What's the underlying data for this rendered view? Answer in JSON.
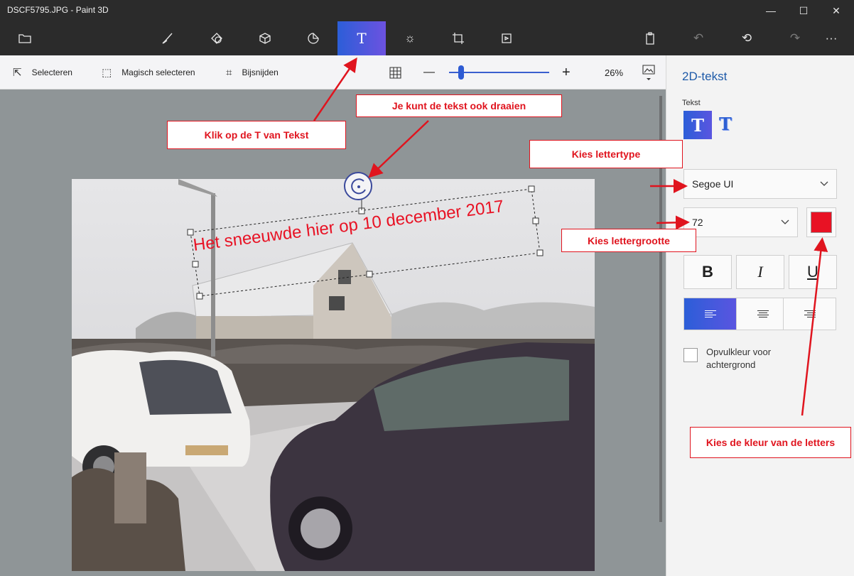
{
  "window": {
    "title": "DSCF5795.JPG - Paint 3D",
    "controls": [
      "—",
      "☐",
      "✕"
    ]
  },
  "toolbar": {
    "tools": [
      {
        "name": "menu",
        "glyph": "🗀"
      },
      {
        "name": "brushes",
        "glyph": "✎"
      },
      {
        "name": "2d-shapes",
        "glyph": "◇"
      },
      {
        "name": "3d-shapes",
        "glyph": "⬡"
      },
      {
        "name": "stickers",
        "glyph": "◔"
      },
      {
        "name": "text",
        "glyph": "T"
      },
      {
        "name": "effects",
        "glyph": "☼"
      },
      {
        "name": "canvas",
        "glyph": "⌗"
      },
      {
        "name": "3d-library",
        "glyph": "⧉"
      }
    ],
    "right": [
      {
        "name": "paste",
        "glyph": "⎘"
      },
      {
        "name": "undo",
        "glyph": "↶"
      },
      {
        "name": "history",
        "glyph": "⟲"
      },
      {
        "name": "redo",
        "glyph": "↷"
      },
      {
        "name": "more",
        "glyph": "···"
      }
    ]
  },
  "subbar": {
    "select_label": "Selecteren",
    "magic_label": "Magisch selecteren",
    "crop_label": "Bijsnijden",
    "zoom_minus": "—",
    "zoom_plus": "+",
    "zoom_value": "26%",
    "zoom_level_fraction": 0.1
  },
  "canvas": {
    "text_on_photo": "Het sneeuwde hier op 10 december 2017",
    "text_color": "#e81224"
  },
  "panel": {
    "title": "2D-tekst",
    "text_label": "Tekst",
    "text_2d_glyph": "T",
    "text_3d_glyph": "T",
    "font_family": "Segoe UI",
    "font_size": "72",
    "color": "#e81224",
    "bold": "B",
    "italic": "I",
    "underline": "U",
    "fill_label": "Opvulkleur voor achtergrond",
    "chevron": "⌄"
  },
  "annotations": {
    "click_text": "Klik op de T van Tekst",
    "rotate": "Je kunt de tekst ook draaien",
    "font_type": "Kies lettertype",
    "font_size": "Kies lettergrootte",
    "color": "Kies de kleur van de letters",
    "arrow_color": "#e0141e"
  },
  "colors": {
    "accent": "#2c5ed8",
    "titlebar": "#2b2b2b",
    "panel_title": "#1e5aa8"
  }
}
